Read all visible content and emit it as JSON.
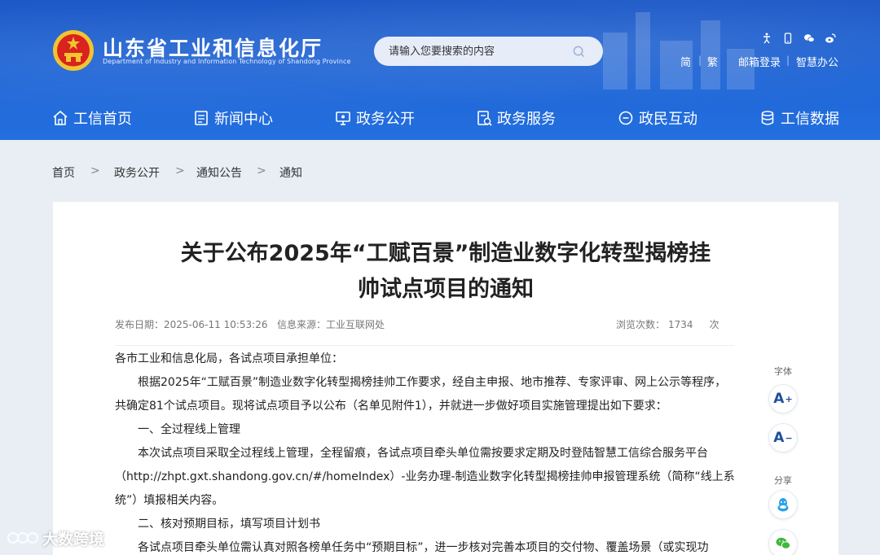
{
  "header": {
    "site_title": "山东省工业和信息化厅",
    "site_subtitle": "Department of Industry and Information Technology of Shandong Province",
    "search_placeholder": "请输入您要搜索的内容",
    "links": {
      "simplified": "简",
      "traditional": "繁",
      "mail_login": "邮箱登录",
      "smart_office": "智慧办公"
    },
    "access_icons": [
      "accessibility-icon",
      "mobile-icon",
      "wechat-icon",
      "weibo-icon"
    ]
  },
  "nav": {
    "items": [
      {
        "label": "工信首页",
        "icon": "home-icon"
      },
      {
        "label": "新闻中心",
        "icon": "news-icon"
      },
      {
        "label": "政务公开",
        "icon": "monitor-icon"
      },
      {
        "label": "政务服务",
        "icon": "service-icon"
      },
      {
        "label": "政民互动",
        "icon": "chat-icon"
      },
      {
        "label": "工信数据",
        "icon": "database-icon"
      }
    ]
  },
  "breadcrumb": {
    "items": [
      "首页",
      "政务公开",
      "通知公告",
      "通知"
    ],
    "separator": ">"
  },
  "article": {
    "title_line1": "关于公布2025年“工赋百景”制造业数字化转型揭榜挂",
    "title_line2": "帅试点项目的通知",
    "publish_label": "发布日期：",
    "publish_date": "2025-06-11 10:53:26",
    "source_label": "信息来源：",
    "source": "工业互联网处",
    "views_label": "浏览次数：",
    "views": "1734",
    "views_unit": "次",
    "paragraphs": [
      "各市工业和信息化局，各试点项目承担单位：",
      "根据2025年“工赋百景”制造业数字化转型揭榜挂帅工作要求，经自主申报、地市推荐、专家评审、网上公示等程序，共确定81个试点项目。现将试点项目予以公布（名单见附件1），并就进一步做好项目实施管理提出如下要求：",
      "一、全过程线上管理",
      "本次试点项目采取全过程线上管理，全程留痕，各试点项目牵头单位需按要求定期及时登陆智慧工信综合服务平台（http://zhpt.gxt.shandong.gov.cn/#/homeIndex）-业务办理-制造业数字化转型揭榜挂帅申报管理系统（简称“线上系统”）填报相关内容。",
      "二、核对预期目标，填写项目计划书",
      "各试点项目牵头单位需认真对照各榜单任务中“预期目标”，进一步核对完善本项目的交付物、覆盖场景（或实现功"
    ]
  },
  "tools": {
    "font_label": "字体",
    "font_increase": "A",
    "font_increase_sign": "+",
    "font_decrease": "A",
    "font_decrease_sign": "−",
    "share_label": "分享",
    "share_icons": [
      "qq-icon",
      "wechat-share-icon"
    ]
  },
  "watermark": {
    "text": "大数跨境"
  },
  "colors": {
    "header_blue": "#1d64d6",
    "page_bg": "#e9eef5",
    "tool_blue": "#1f4f9e"
  }
}
